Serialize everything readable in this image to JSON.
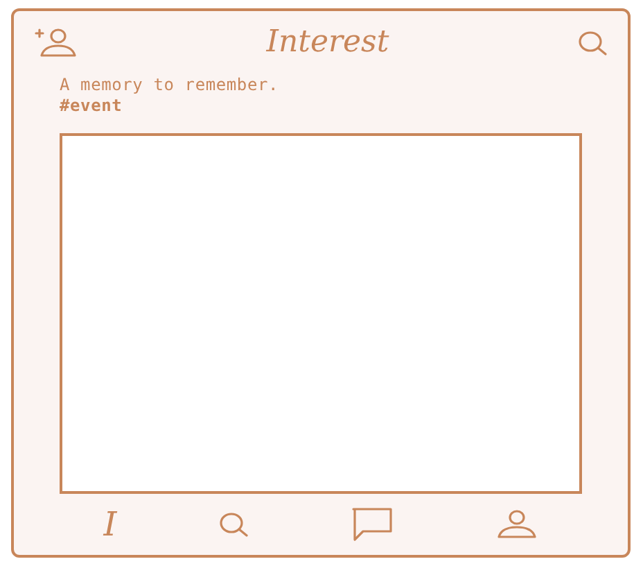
{
  "header": {
    "title": "Interest"
  },
  "post": {
    "caption": "A memory to remember.",
    "tag": "#event"
  },
  "nav": [
    {
      "kind": "logo",
      "label": "I"
    },
    {
      "kind": "search"
    },
    {
      "kind": "chat"
    },
    {
      "kind": "profile"
    }
  ]
}
